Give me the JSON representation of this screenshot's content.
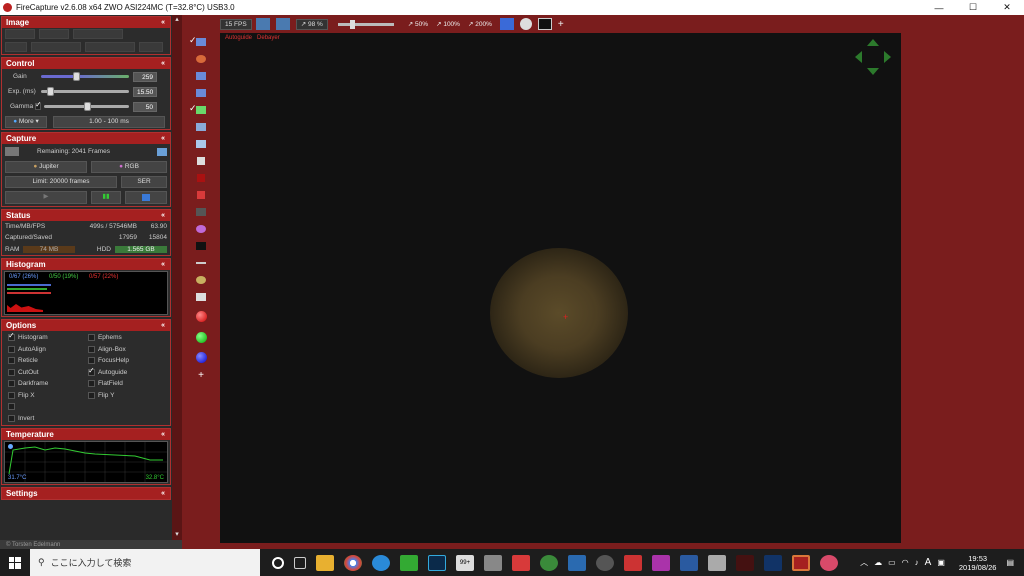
{
  "window": {
    "title": "FireCapture v2.6.08  x64     ZWO ASI224MC (T=32.8°C) USB3.0",
    "min": "—",
    "max": "☐",
    "close": "✕"
  },
  "image": {
    "title": "Image",
    "collapse": "«"
  },
  "control": {
    "title": "Control",
    "collapse": "«",
    "gain_label": "Gain",
    "gain_value": "259",
    "exp_label": "Exp. (ms)",
    "exp_value": "15.50",
    "gamma_label": "Gamma",
    "gamma_value": "50",
    "more_label": "More",
    "range": "1.00 - 100 ms"
  },
  "capture": {
    "title": "Capture",
    "collapse": "«",
    "remaining": "Remaining: 2041 Frames",
    "object": "Jupiter",
    "color": "RGB",
    "limit": "Limit: 20000 frames",
    "format": "SER"
  },
  "status": {
    "title": "Status",
    "collapse": "«",
    "r1_label": "Time/MB/FPS",
    "r1_v1": "499s / 57546MB",
    "r1_v2": "63.90",
    "r2_label": "Captured/Saved",
    "r2_v1": "17959",
    "r2_v2": "15804",
    "ram_label": "RAM",
    "ram_value": "74 MB",
    "hdd_label": "HDD",
    "hdd_value": "1.565 GB"
  },
  "histogram": {
    "title": "Histogram",
    "collapse": "«",
    "blue": "0/67 (26%)",
    "green": "0/50 (19%)",
    "red": "0/57 (22%)"
  },
  "options": {
    "title": "Options",
    "collapse": "«",
    "left": [
      {
        "label": "Histogram",
        "on": true
      },
      {
        "label": "AutoAlign",
        "on": false
      },
      {
        "label": "Reticle",
        "on": false
      },
      {
        "label": "CutOut",
        "on": false
      },
      {
        "label": "Darkframe",
        "on": false
      },
      {
        "label": "Flip X",
        "on": false
      }
    ],
    "right": [
      {
        "label": "Ephems",
        "on": false
      },
      {
        "label": "Align-Box",
        "on": false
      },
      {
        "label": "FocusHelp",
        "on": false
      },
      {
        "label": "Autoguide",
        "on": true
      },
      {
        "label": "FlatField",
        "on": false
      },
      {
        "label": "Flip Y",
        "on": false
      }
    ],
    "invert": "Invert"
  },
  "temperature": {
    "title": "Temperature",
    "collapse": "«",
    "min": "31.7°C",
    "cur": "32.8°C"
  },
  "settings": {
    "title": "Settings",
    "collapse": "«"
  },
  "footer": "© Torsten Edelmann",
  "toolbar": {
    "fps": "15 FPS",
    "zoom_pct": "98 %",
    "z50": "50%",
    "z100": "100%",
    "z200": "200%",
    "plus": "+"
  },
  "preview": {
    "autoguide": "Autoguide",
    "debayer": "Debayer",
    "crosshair": "+"
  },
  "vplus": "+",
  "taskbar": {
    "search": "ここに入力して検索",
    "time": "19:53",
    "date": "2019/08/26",
    "ime": "A",
    "notif": "99+"
  },
  "colors": {
    "accent": "#a52020",
    "bg": "#7a1d1d",
    "panel": "#2c2c2c"
  }
}
